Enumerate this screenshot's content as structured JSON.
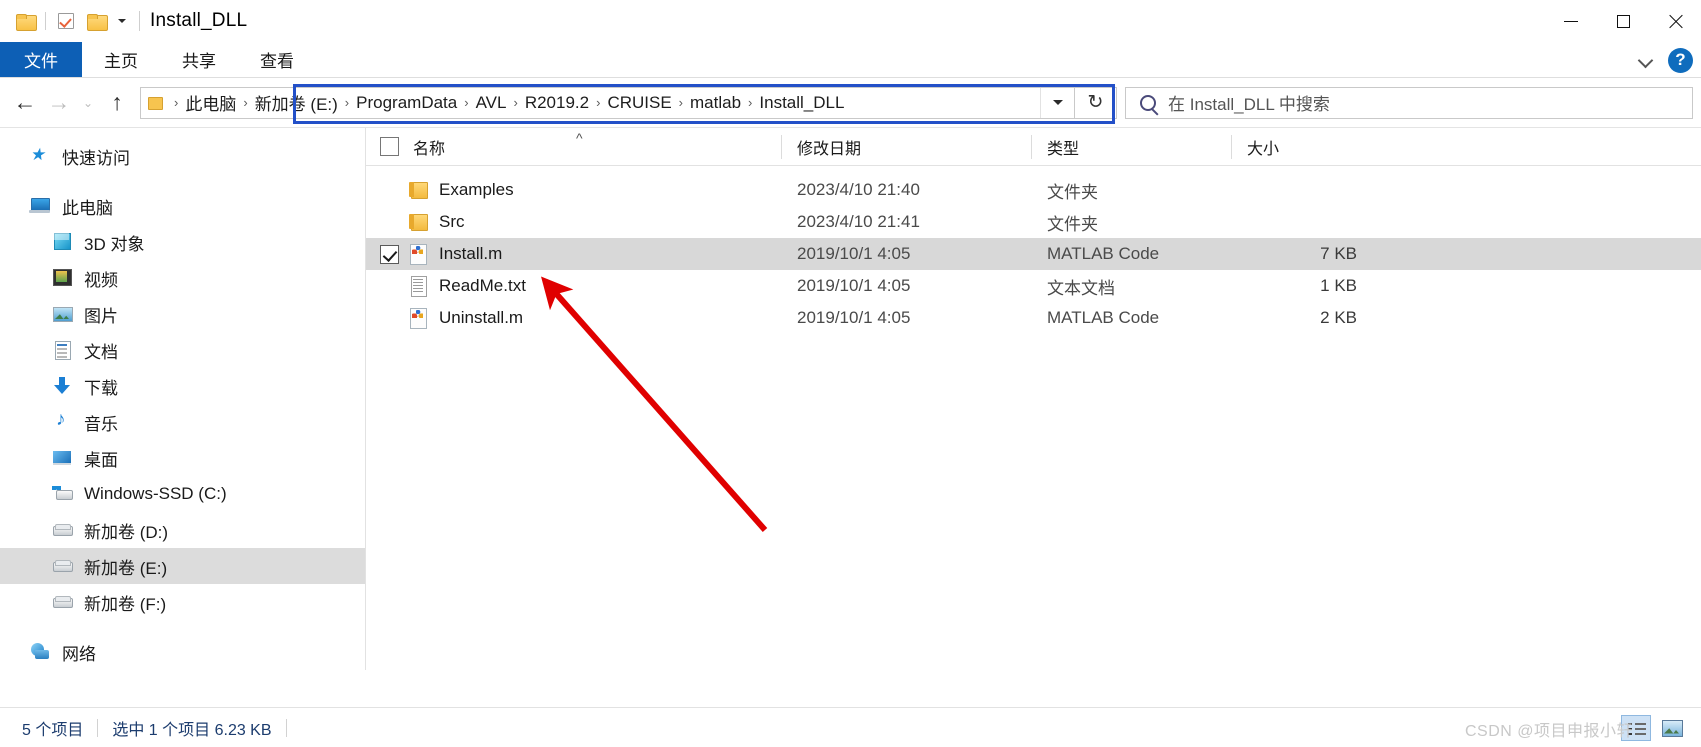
{
  "window": {
    "title": "Install_DLL",
    "quick_access": {
      "folder_icon": "folder-icon",
      "properties_icon": "checkbox-check-icon",
      "new_folder_icon": "folder-icon",
      "customize_caret": "chevron-down-icon"
    },
    "controls": {
      "minimize": "minimize-icon",
      "maximize": "maximize-icon",
      "close": "close-icon"
    }
  },
  "ribbon": {
    "tabs": [
      {
        "label": "文件",
        "active": true
      },
      {
        "label": "主页",
        "active": false
      },
      {
        "label": "共享",
        "active": false
      },
      {
        "label": "查看",
        "active": false
      }
    ],
    "collapse_icon": "chevron-down-icon",
    "help_label": "?"
  },
  "navigation": {
    "back_icon": "arrow-left-icon",
    "forward_icon": "arrow-right-icon",
    "recent_icon": "chevron-down-icon",
    "up_icon": "arrow-up-icon",
    "address": {
      "root_icon": "folder-icon",
      "separator": "›",
      "crumbs": [
        "此电脑",
        "新加卷 (E:)",
        "ProgramData",
        "AVL",
        "R2019.2",
        "CRUISE",
        "matlab",
        "Install_DLL"
      ],
      "dropdown_icon": "chevron-down-icon",
      "highlight_color": "#2350c8"
    },
    "refresh_icon": "↻",
    "search": {
      "icon": "search-icon",
      "placeholder": "在 Install_DLL 中搜索",
      "value": ""
    }
  },
  "sidebar": {
    "items": [
      {
        "label": "快速访问",
        "icon": "star-icon",
        "indent": false,
        "selected": false
      },
      {
        "label": "此电脑",
        "icon": "this-pc-icon",
        "indent": false,
        "selected": false
      },
      {
        "label": "3D 对象",
        "icon": "3d-objects-icon",
        "indent": true,
        "selected": false
      },
      {
        "label": "视频",
        "icon": "videos-icon",
        "indent": true,
        "selected": false
      },
      {
        "label": "图片",
        "icon": "pictures-icon",
        "indent": true,
        "selected": false
      },
      {
        "label": "文档",
        "icon": "documents-icon",
        "indent": true,
        "selected": false
      },
      {
        "label": "下载",
        "icon": "downloads-icon",
        "indent": true,
        "selected": false
      },
      {
        "label": "音乐",
        "icon": "music-icon",
        "indent": true,
        "selected": false
      },
      {
        "label": "桌面",
        "icon": "desktop-icon",
        "indent": true,
        "selected": false
      },
      {
        "label": "Windows-SSD (C:)",
        "icon": "windows-drive-icon",
        "indent": true,
        "selected": false
      },
      {
        "label": "新加卷 (D:)",
        "icon": "drive-icon",
        "indent": true,
        "selected": false
      },
      {
        "label": "新加卷 (E:)",
        "icon": "drive-icon",
        "indent": true,
        "selected": true
      },
      {
        "label": "新加卷 (F:)",
        "icon": "drive-icon",
        "indent": true,
        "selected": false
      },
      {
        "label": "网络",
        "icon": "network-icon",
        "indent": false,
        "selected": false
      }
    ]
  },
  "file_list": {
    "columns": [
      {
        "label": "名称",
        "sorted": true,
        "sort_icon": "^"
      },
      {
        "label": "修改日期",
        "sorted": false,
        "sort_icon": ""
      },
      {
        "label": "类型",
        "sorted": false,
        "sort_icon": ""
      },
      {
        "label": "大小",
        "sorted": false,
        "sort_icon": ""
      }
    ],
    "select_all_checkbox": false,
    "rows": [
      {
        "name": "Examples",
        "date": "2023/4/10 21:40",
        "type": "文件夹",
        "size": "",
        "icon": "folder-icon",
        "checked": false,
        "selected": false
      },
      {
        "name": "Src",
        "date": "2023/4/10 21:41",
        "type": "文件夹",
        "size": "",
        "icon": "folder-icon",
        "checked": false,
        "selected": false
      },
      {
        "name": "Install.m",
        "date": "2019/10/1 4:05",
        "type": "MATLAB Code",
        "size": "7 KB",
        "icon": "matlab-file-icon",
        "checked": true,
        "selected": true
      },
      {
        "name": "ReadMe.txt",
        "date": "2019/10/1 4:05",
        "type": "文本文档",
        "size": "1 KB",
        "icon": "text-file-icon",
        "checked": false,
        "selected": false
      },
      {
        "name": "Uninstall.m",
        "date": "2019/10/1 4:05",
        "type": "MATLAB Code",
        "size": "2 KB",
        "icon": "matlab-file-icon",
        "checked": false,
        "selected": false
      }
    ]
  },
  "annotation": {
    "arrow_color": "#e00000",
    "points_to": "Install.m"
  },
  "status_bar": {
    "item_count": "5 个项目",
    "selection": "选中 1 个项目  6.23 KB",
    "view_details_icon": "details-view-icon",
    "view_thumbnails_icon": "thumbnails-view-icon",
    "watermark": "CSDN @项目申报小轩"
  }
}
